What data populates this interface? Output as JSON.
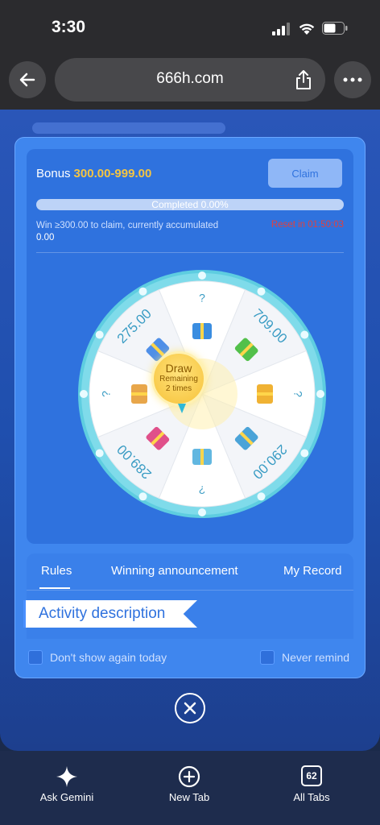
{
  "status": {
    "time": "3:30"
  },
  "browser": {
    "url": "666h.com"
  },
  "modal": {
    "bonus_label": "Bonus",
    "bonus_amount": "300.00-999.00",
    "claim_label": "Claim",
    "progress_text": "Completed 0.00%",
    "progress_fraction": 0.0,
    "win_note_prefix": "Win ≥300.00 to claim, currently accumulated ",
    "win_note_value": "0.00",
    "reset_text": "Reset in 01:50:03"
  },
  "wheel": {
    "segments": [
      "?",
      "709.00",
      "?",
      "290.00",
      "?",
      "289.00",
      "?",
      "275.00"
    ],
    "draw_title": "Draw",
    "draw_sub1": "Remaining",
    "draw_sub2": "2  times"
  },
  "tabs": {
    "rules": "Rules",
    "winning": "Winning announcement",
    "record": "My Record"
  },
  "activity_title": "Activity description",
  "checks": {
    "dont_show": "Don't show again today",
    "never_remind": "Never remind"
  },
  "bottom": {
    "gemini": "Ask Gemini",
    "new_tab": "New Tab",
    "all_tabs": "All Tabs",
    "tab_count": "62"
  },
  "colors": {
    "accent_gold": "#f5c542",
    "modal_blue": "#3f86ee",
    "reset_red": "#e0413f"
  }
}
